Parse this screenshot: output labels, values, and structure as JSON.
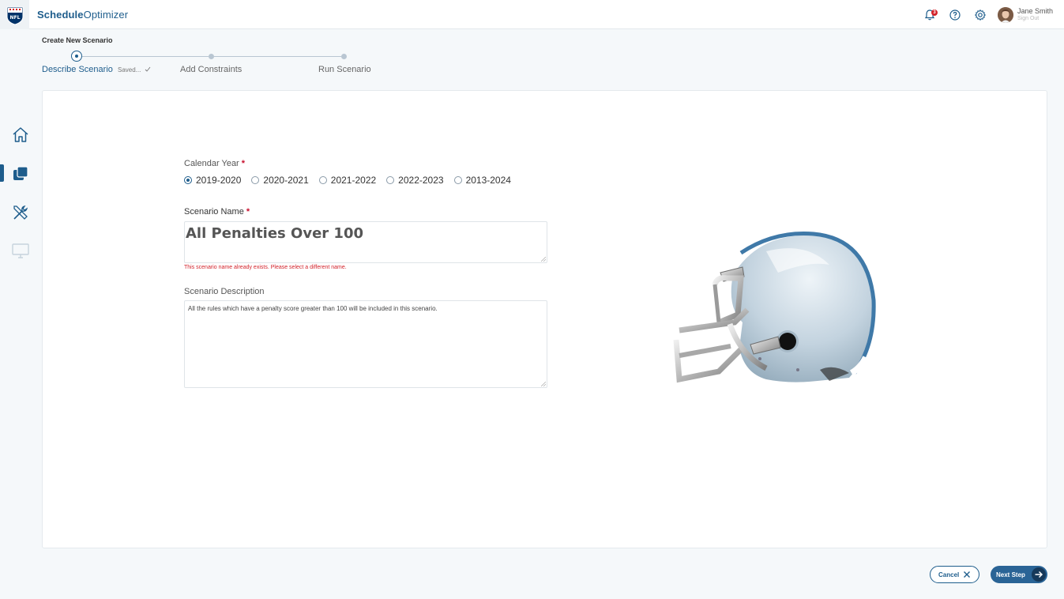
{
  "header": {
    "logo_text": "NFL",
    "app_name_bold": "Schedule",
    "app_name_rest": "Optimizer",
    "notification_count": "3",
    "user_name": "Jane Smith",
    "sign_out": "Sign Out"
  },
  "stepper": {
    "page_heading": "Create New Scenario",
    "steps": [
      {
        "label": "Describe Scenario",
        "active": true
      },
      {
        "label": "Add Constraints",
        "active": false
      },
      {
        "label": "Run Scenario",
        "active": false
      }
    ],
    "saved_status": "Saved..."
  },
  "form": {
    "calendar_year_label": "Calendar Year",
    "required_mark": "*",
    "year_options": [
      "2019-2020",
      "2020-2021",
      "2021-2022",
      "2022-2023",
      "2013-2024"
    ],
    "selected_year": "2019-2020",
    "scenario_name_label": "Scenario Name",
    "scenario_name_value": "All Penalties Over 100",
    "scenario_name_error": "This scenario name already exists. Please select a different name.",
    "description_label": "Scenario Description",
    "description_value": "All the rules which have a penalty score greater than 100 will be included in this scenario."
  },
  "footer": {
    "cancel_label": "Cancel",
    "next_label": "Next Step"
  },
  "colors": {
    "brand": "#1e5d8c",
    "error": "#d3222a",
    "next_button": "#2a6496"
  }
}
